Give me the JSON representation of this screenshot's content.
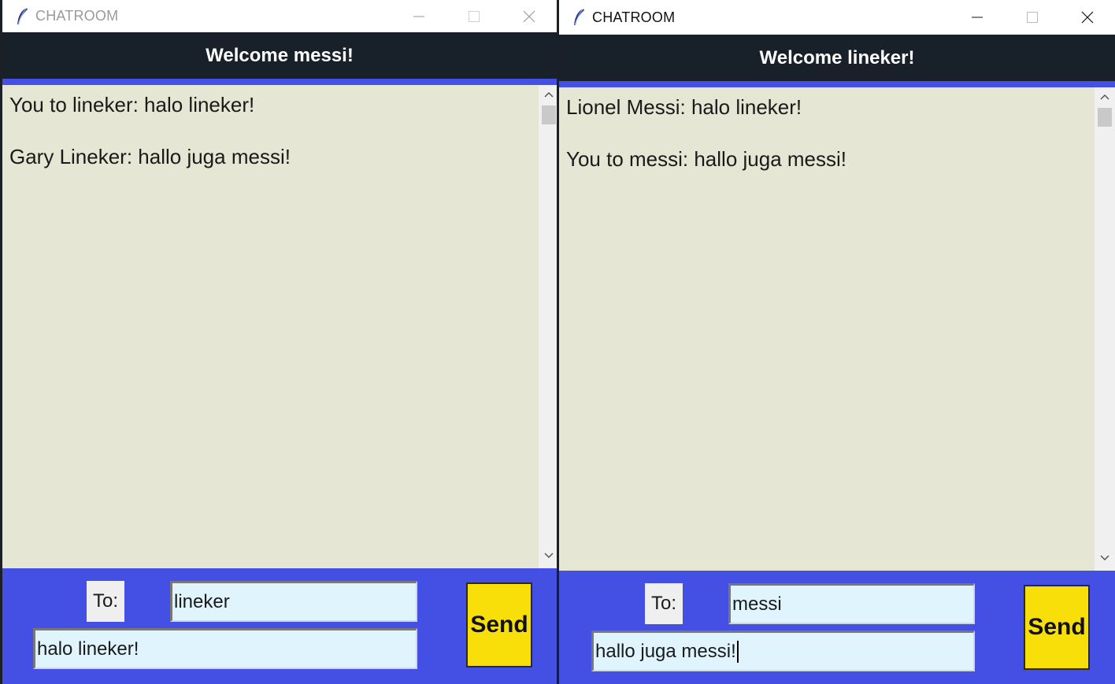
{
  "windows": [
    {
      "id": "left",
      "title": "CHATROOM",
      "welcome": "Welcome messi!",
      "messages": [
        "You to lineker: halo lineker!",
        "Gary Lineker: hallo juga messi!"
      ],
      "to_label": "To:",
      "to_value": "lineker",
      "message_value": "halo lineker!",
      "send_label": "Send",
      "focused": false
    },
    {
      "id": "right",
      "title": "CHATROOM",
      "welcome": "Welcome lineker!",
      "messages": [
        "Lionel Messi: halo lineker!",
        "You to messi: hallo juga messi!"
      ],
      "to_label": "To:",
      "to_value": "messi",
      "message_value": "hallo juga messi!",
      "send_label": "Send",
      "focused": true
    }
  ],
  "colors": {
    "header_bg": "#18202a",
    "accent_blue": "#4350e3",
    "chat_bg": "#e5e6d4",
    "input_bg": "#dff4fd",
    "send_bg": "#f8df09"
  },
  "icons": [
    "feather-icon",
    "minimize-icon",
    "maximize-icon",
    "close-icon",
    "scroll-up-icon",
    "scroll-down-icon"
  ]
}
